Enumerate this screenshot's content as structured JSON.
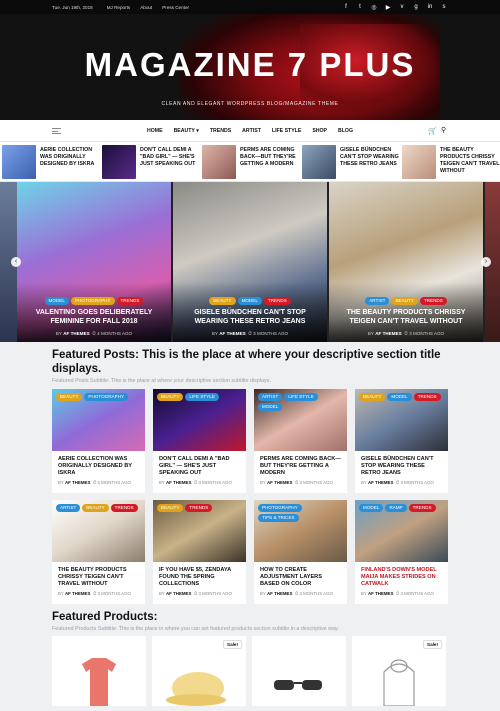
{
  "topbar": {
    "date": "Tue. Jun 19th, 2018",
    "links": [
      "MJ Reports",
      "About",
      "Press Center"
    ],
    "social_icons": [
      "facebook-icon",
      "twitter-icon",
      "instagram-icon",
      "youtube-icon",
      "vk-icon",
      "googleplus-icon",
      "linkedin-icon",
      "skype-icon"
    ]
  },
  "site": {
    "title": "MAGAZINE 7 PLUS",
    "tagline": "CLEAN AND ELEGANT WORDPRESS BLOG/MAGAZINE THEME"
  },
  "nav": {
    "items": [
      "HOME",
      "BEAUTY ▾",
      "TRENDS",
      "ARTIST",
      "LIFE STYLE",
      "SHOP",
      "BLOG"
    ]
  },
  "ticker": [
    {
      "title": "AERIE COLLECTION WAS ORIGINALLY DESIGNED BY ISKRA",
      "color": "#6c8fd6"
    },
    {
      "title": "DON'T CALL DEMI A \"BAD GIRL\" — SHE'S JUST SPEAKING OUT",
      "color": "#3a1d5c"
    },
    {
      "title": "PERMS ARE COMING BACK—BUT THEY'RE GETTING A MODERN",
      "color": "#c79a8f"
    },
    {
      "title": "GISELE BÜNDCHEN CAN'T STOP WEARING THESE RETRO JEANS",
      "color": "#5a6e8a"
    },
    {
      "title": "THE BEAUTY PRODUCTS CHRISSY TEIGEN CAN'T TRAVEL WITHOUT",
      "color": "#d9b8a8"
    }
  ],
  "slides": [
    {
      "tags": [
        [
          "MODEL",
          "#2a8fd6"
        ],
        [
          "PHOTOGRAPHY",
          "#e0a41a"
        ],
        [
          "TRENDS",
          "#d31b28"
        ]
      ],
      "title": "VALENTINO GOES DELIBERATELY FEMININE FOR FALL 2018",
      "by": "BY",
      "author": "AF THEMES",
      "time": "4 MONTHS AGO"
    },
    {
      "tags": [
        [
          "BEAUTY",
          "#e0a41a"
        ],
        [
          "MODEL",
          "#2a8fd6"
        ],
        [
          "TRENDS",
          "#d31b28"
        ]
      ],
      "title": "GISELE BÜNDCHEN CAN'T STOP WEARING THESE RETRO JEANS",
      "by": "BY",
      "author": "AF THEMES",
      "time": "3 MONTHS AGO"
    },
    {
      "tags": [
        [
          "ARTIST",
          "#2a8fd6"
        ],
        [
          "BEAUTY",
          "#e0a41a"
        ],
        [
          "TRENDS",
          "#d31b28"
        ]
      ],
      "title": "THE BEAUTY PRODUCTS CHRISSY TEIGEN CAN'T TRAVEL WITHOUT",
      "by": "BY",
      "author": "AF THEMES",
      "time": "3 MONTHS AGO"
    }
  ],
  "featured": {
    "title": "Featured Posts: This is the place at where your descriptive section title displays.",
    "subtitle": "Featured Posts Subtitle: This is the place at where your descriptive section subtitle displays.",
    "cards": [
      {
        "tags": [
          [
            "BEAUTY",
            "#e0a41a"
          ],
          [
            "PHOTOGRAPHY",
            "#2a8fd6"
          ]
        ],
        "title": "AERIE COLLECTION WAS ORIGINALLY DESIGNED BY ISKRA",
        "time": "5 MONTHS AGO",
        "red": false
      },
      {
        "tags": [
          [
            "BEAUTY",
            "#e0a41a"
          ],
          [
            "LIFE STYLE",
            "#2a8fd6"
          ]
        ],
        "title": "DON'T CALL DEMI A \"BAD GIRL\" — SHE'S JUST SPEAKING OUT",
        "time": "3 MONTHS AGO",
        "red": false
      },
      {
        "tags": [
          [
            "ARTIST",
            "#2a8fd6"
          ],
          [
            "LIFE STYLE",
            "#2a8fd6"
          ],
          [
            "MODEL",
            "#2a8fd6"
          ]
        ],
        "title": "PERMS ARE COMING BACK—BUT THEY'RE GETTING A MODERN",
        "time": "3 MONTHS AGO",
        "red": false
      },
      {
        "tags": [
          [
            "BEAUTY",
            "#e0a41a"
          ],
          [
            "MODEL",
            "#2a8fd6"
          ],
          [
            "TRENDS",
            "#d31b28"
          ]
        ],
        "title": "GISELE BÜNDCHEN CAN'T STOP WEARING THESE RETRO JEANS",
        "time": "3 MONTHS AGO",
        "red": false
      },
      {
        "tags": [
          [
            "ARTIST",
            "#2a8fd6"
          ],
          [
            "BEAUTY",
            "#e0a41a"
          ],
          [
            "TRENDS",
            "#d31b28"
          ]
        ],
        "title": "THE BEAUTY PRODUCTS CHRISSY TEIGEN CAN'T TRAVEL WITHOUT",
        "time": "3 MONTHS AGO",
        "red": false
      },
      {
        "tags": [
          [
            "BEAUTY",
            "#e0a41a"
          ],
          [
            "TRENDS",
            "#d31b28"
          ]
        ],
        "title": "IF YOU HAVE $5, ZENDAYA FOUND THE SPRING COLLECTIONS",
        "time": "3 MONTHS AGO",
        "red": false
      },
      {
        "tags": [
          [
            "PHOTOGRAPHY",
            "#2a8fd6"
          ],
          [
            "TIPS & TRICKS",
            "#2a8fd6"
          ]
        ],
        "title": "HOW TO CREATE ADJUSTMENT LAYERS BASED ON COLOR",
        "time": "3 MONTHS AGO",
        "red": false
      },
      {
        "tags": [
          [
            "MODEL",
            "#2a8fd6"
          ],
          [
            "RAMP",
            "#2a8fd6"
          ],
          [
            "TRENDS",
            "#d31b28"
          ]
        ],
        "title": "FINLAND'S DOWN'S MODEL MAIJA MAKES STRIDES ON CATWALK",
        "time": "3 MONTHS AGO",
        "red": true
      }
    ],
    "by": "BY",
    "author": "AF THEMES"
  },
  "products": {
    "title": "Featured Products:",
    "subtitle": "Featured Products Subtitle: This is the place in where you can set featured products section subtitle in a descriptive way.",
    "sale_label": "Sale!"
  }
}
